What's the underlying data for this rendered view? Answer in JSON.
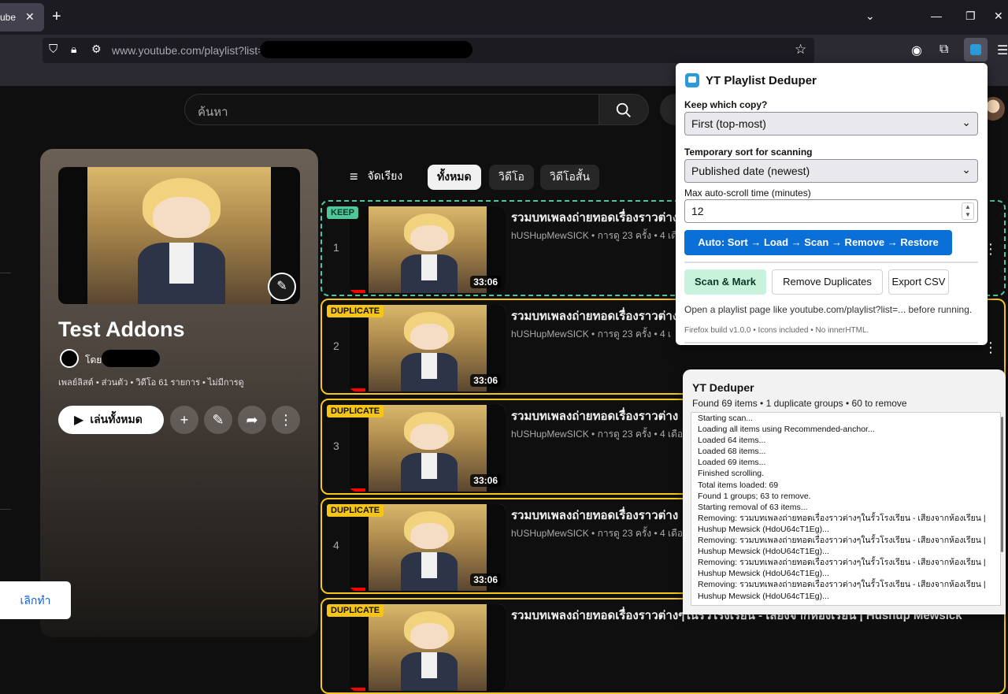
{
  "browser": {
    "tab_title": "ube",
    "url": "www.youtube.com/playlist?list="
  },
  "youtube": {
    "search_placeholder": "ค้นหา",
    "playlist": {
      "title": "Test Addons",
      "owner_prefix": "โดย",
      "meta": "เพลย์ลิสต์ • ส่วนตัว • วิดีโอ 61 รายการ • ไม่มีการดู",
      "play_all": "เล่นทั้งหมด"
    },
    "sort_label": "จัดเรียง",
    "chips": [
      "ทั้งหมด",
      "วิดีโอ",
      "วิดีโอสั้น"
    ],
    "videos": [
      {
        "index": "1",
        "badge": "KEEP",
        "state": "keep",
        "title": "รวมบทเพลงถ่ายทอดเรื่องราวต่าง",
        "channel": "hUSHupMewSICK • การดู 23 ครั้ง • 4 เดือน",
        "duration": "33:06"
      },
      {
        "index": "2",
        "badge": "DUPLICATE",
        "state": "dup",
        "title": "รวมบทเพลงถ่ายทอดเรื่องราวต่าง",
        "channel": "hUSHupMewSICK • การดู 23 ครั้ง • 4 เ",
        "duration": "33:06"
      },
      {
        "index": "3",
        "badge": "DUPLICATE",
        "state": "dup",
        "title": "รวมบทเพลงถ่ายทอดเรื่องราวต่าง",
        "channel": "hUSHupMewSICK • การดู 23 ครั้ง • 4 เดือนท",
        "duration": "33:06"
      },
      {
        "index": "4",
        "badge": "DUPLICATE",
        "state": "dup",
        "title": "รวมบทเพลงถ่ายทอดเรื่องราวต่าง",
        "channel": "hUSHupMewSICK • การดู 23 ครั้ง • 4 เดือนท",
        "duration": "33:06"
      },
      {
        "index": "",
        "badge": "DUPLICATE",
        "state": "dup",
        "title": "รวมบทเพลงถ่ายทอดเรื่องราวต่างๆในรั้วโรงเรียน - เสียงจากห้องเรียน | Hushup Mewsick",
        "channel": "",
        "duration": ""
      }
    ],
    "cancel_label": "เลิกทำ"
  },
  "popup": {
    "title": "YT Playlist Deduper",
    "keep_label": "Keep which copy?",
    "keep_value": "First (top-most)",
    "sort_label": "Temporary sort for scanning",
    "sort_value": "Published date (newest)",
    "scroll_label": "Max auto-scroll time (minutes)",
    "scroll_value": "12",
    "auto_button": "Auto: Sort → Load → Scan → Remove → Restore",
    "scan_button": "Scan & Mark",
    "remove_button": "Remove Duplicates",
    "export_button": "Export CSV",
    "hint": "Open a playlist page like youtube.com/playlist?list=... before running.",
    "footer": "Firefox build v1.0.0 • Icons included • No innerHTML."
  },
  "log_panel": {
    "title": "YT Deduper",
    "summary": "Found 69 items • 1 duplicate groups • 60 to remove",
    "lines": [
      "Starting scan...",
      "Loading all items using Recommended-anchor...",
      "Loaded 64 items...",
      "Loaded 68 items...",
      "Loaded 69 items...",
      "Finished scrolling.",
      "Total items loaded: 69",
      "Found 1 groups; 63 to remove.",
      "Starting removal of 63 items...",
      "Removing: รวมบทเพลงถ่ายทอดเรื่องราวต่างๆในรั้วโรงเรียน - เสียงจากห้องเรียน |",
      "Hushup Mewsick (HdoU64cT1Eg)...",
      "Removing: รวมบทเพลงถ่ายทอดเรื่องราวต่างๆในรั้วโรงเรียน - เสียงจากห้องเรียน |",
      "Hushup Mewsick (HdoU64cT1Eg)...",
      "Removing: รวมบทเพลงถ่ายทอดเรื่องราวต่างๆในรั้วโรงเรียน - เสียงจากห้องเรียน |",
      "Hushup Mewsick (HdoU64cT1Eg)...",
      "Removing: รวมบทเพลงถ่ายทอดเรื่องราวต่างๆในรั้วโรงเรียน - เสียงจากห้องเรียน |",
      "Hushup Mewsick (HdoU64cT1Eg)..."
    ]
  },
  "colors": {
    "keep": "#4fc79a",
    "duplicate": "#f5c518",
    "primary": "#0b6fd8"
  }
}
